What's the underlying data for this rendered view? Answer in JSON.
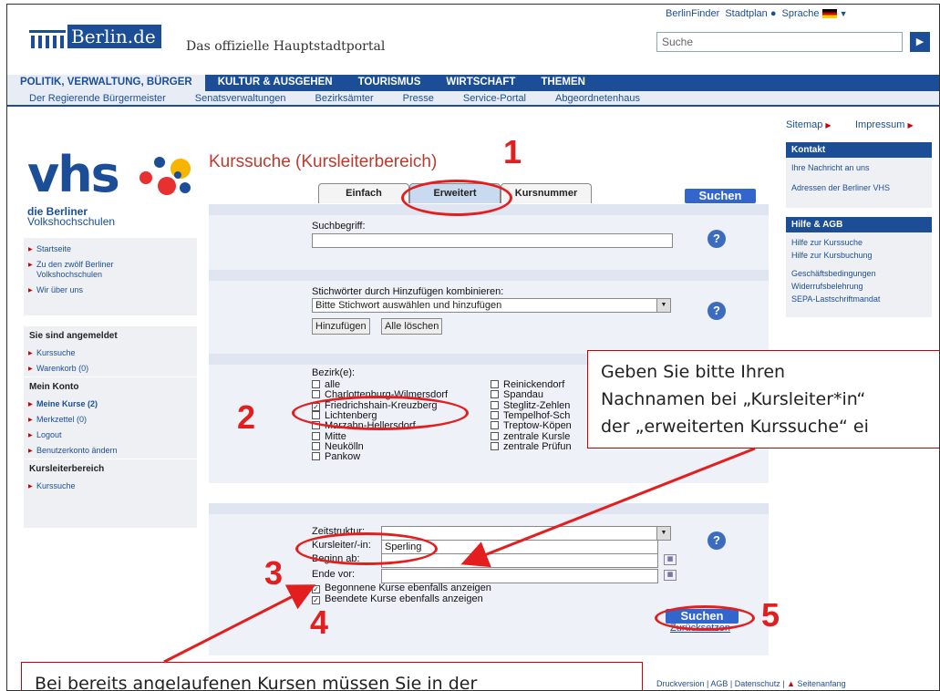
{
  "header": {
    "logo": "Berlin.de",
    "tagline": "Das offizielle Hauptstadtportal",
    "top_links": [
      "BerlinFinder",
      "Stadtplan",
      "Sprache"
    ],
    "search_placeholder": "Suche"
  },
  "main_nav": [
    "POLITIK, VERWALTUNG, BÜRGER",
    "KULTUR & AUSGEHEN",
    "TOURISMUS",
    "WIRTSCHAFT",
    "THEMEN"
  ],
  "sub_nav": [
    "Der Regierende Bürgermeister",
    "Senatsverwaltungen",
    "Bezirksämter",
    "Presse",
    "Service-Portal",
    "Abgeordnetenhaus"
  ],
  "vhs": {
    "logo": "vhs",
    "sub1": "die Berliner",
    "sub2": "Volkshochschulen"
  },
  "left_nav": {
    "items": [
      "Startseite",
      "Zu den zwölf Berliner Volkshochschulen",
      "Wir über uns"
    ],
    "logged_in_header": "Sie sind angemeldet",
    "logged_in_items": [
      "Kurssuche",
      "Warenkorb (0)"
    ],
    "account_header": "Mein Konto",
    "account_items": [
      "Meine Kurse (2)",
      "Merkzettel (0)",
      "Logout",
      "Benutzerkonto ändern"
    ],
    "leader_header": "Kursleiterbereich",
    "leader_items": [
      "Kurssuche"
    ]
  },
  "page_title": "Kurssuche (Kursleiterbereich)",
  "tabs": [
    "Einfach",
    "Erweitert",
    "Kursnummer"
  ],
  "search_button": "Suchen",
  "reset_link": "Zurücksetzen",
  "form": {
    "suchbegriff_label": "Suchbegriff:",
    "stichwort_label": "Stichwörter durch Hinzufügen kombinieren:",
    "stichwort_select": "Bitte Stichwort auswählen und hinzufügen",
    "add_button": "Hinzufügen",
    "clear_button": "Alle löschen",
    "bezirk_label": "Bezirk(e):",
    "bezirke_left": [
      {
        "label": "alle",
        "checked": false
      },
      {
        "label": "Charlottenburg-Wilmersdorf",
        "checked": false
      },
      {
        "label": "Friedrichshain-Kreuzberg",
        "checked": true
      },
      {
        "label": "Lichtenberg",
        "checked": false
      },
      {
        "label": "Marzahn-Hellersdorf",
        "checked": false
      },
      {
        "label": "Mitte",
        "checked": false
      },
      {
        "label": "Neukölln",
        "checked": false
      },
      {
        "label": "Pankow",
        "checked": false
      }
    ],
    "bezirke_right": [
      {
        "label": "Reinickendorf",
        "checked": false
      },
      {
        "label": "Spandau",
        "checked": false
      },
      {
        "label": "Steglitz-Zehlen",
        "checked": false
      },
      {
        "label": "Tempelhof-Sch",
        "checked": false
      },
      {
        "label": "Treptow-Köpen",
        "checked": false
      },
      {
        "label": "zentrale Kursle",
        "checked": false
      },
      {
        "label": "zentrale Prüfun",
        "checked": false
      }
    ],
    "zeitstruktur_label": "Zeitstruktur:",
    "kursleiter_label": "Kursleiter/-in:",
    "kursleiter_value": "Sperling",
    "beginn_label": "Beginn ab:",
    "ende_label": "Ende vor:",
    "begonnene_label": "Begonnene Kurse ebenfalls anzeigen",
    "beendete_label": "Beendete Kurse ebenfalls anzeigen"
  },
  "right_sidebar": {
    "top_links": [
      "Sitemap",
      "Impressum"
    ],
    "kontakt_header": "Kontakt",
    "kontakt_items": [
      "Ihre Nachricht an uns",
      "Adressen der Berliner VHS"
    ],
    "hilfe_header": "Hilfe & AGB",
    "hilfe_items": [
      "Hilfe zur Kurssuche",
      "Hilfe zur Kursbuchung",
      "Geschäftsbedingungen",
      "Widerrufsbelehrung",
      "SEPA-Lastschriftmandat"
    ]
  },
  "footer": [
    "Druckversion",
    "AGB",
    "Datenschutz",
    "Seitenanfang"
  ],
  "annotations": {
    "numbers": [
      "1",
      "2",
      "3",
      "4",
      "5"
    ],
    "callout_top_lines": [
      "Geben Sie bitte Ihren",
      "Nachnamen bei „Kursleiter*in“",
      "der „erweiterten Kurssuche“ ei"
    ],
    "callout_bottom": "Bei bereits angelaufenen Kursen müssen Sie in der"
  },
  "colors": {
    "brand": "#1b4e97",
    "annotation": "#e31e1e",
    "title": "#c0392b"
  }
}
